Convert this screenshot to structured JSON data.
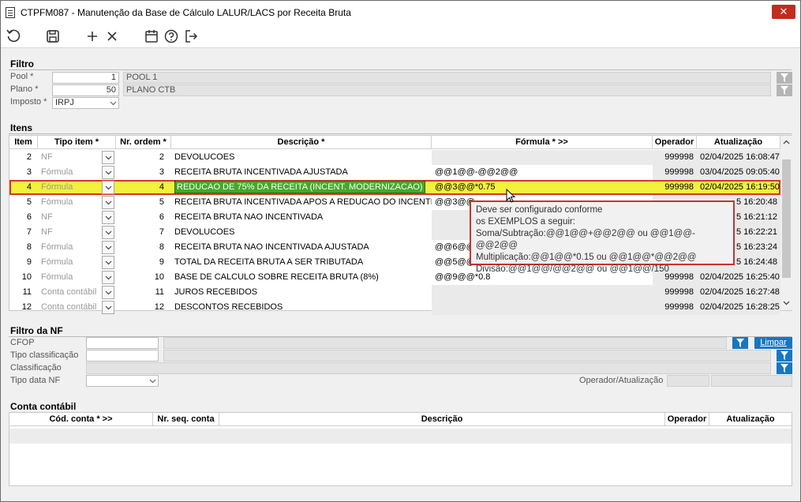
{
  "window": {
    "title": "CTPFM087 - Manutenção da Base de Cálculo LALUR/LACS por Receita Bruta",
    "close": "✕"
  },
  "filtro": {
    "title": "Filtro",
    "pool_label": "Pool *",
    "pool_value": "1",
    "pool_desc": "POOL 1",
    "plano_label": "Plano *",
    "plano_value": "50",
    "plano_desc": "PLANO CTB",
    "imposto_label": "Imposto *",
    "imposto_value": "IRPJ"
  },
  "itens": {
    "title": "Itens",
    "columns": [
      "Item",
      "Tipo item *",
      "Nr. ordem *",
      "Descrição *",
      "Fórmula * >>",
      "Operador",
      "Atualização"
    ],
    "rows": [
      {
        "item": "2",
        "tipo": "NF",
        "ordem": "2",
        "descricao": "DEVOLUCOES",
        "formula": "",
        "operador": "999998",
        "atualizacao": "02/04/2025 16:08:47"
      },
      {
        "item": "3",
        "tipo": "Fórmula",
        "ordem": "3",
        "descricao": "RECEITA BRUTA INCENTIVADA AJUSTADA",
        "formula": "@@1@@-@@2@@",
        "operador": "999998",
        "atualizacao": "03/04/2025 09:05:40"
      },
      {
        "item": "4",
        "tipo": "Fórmula",
        "ordem": "4",
        "descricao": "REDUCAO DE 75% DA RECEITA (INCENT. MODERNIZACAO)",
        "formula": "@@3@@*0.75",
        "operador": "999998",
        "atualizacao": "02/04/2025 16:19:50"
      },
      {
        "item": "5",
        "tipo": "Fórmula",
        "ordem": "5",
        "descricao": "RECEITA BRUTA INCENTIVADA APOS A REDUCAO DO INCENTIVO",
        "formula": "@@3@@",
        "operador": "",
        "atualizacao": "5 16:20:48"
      },
      {
        "item": "6",
        "tipo": "NF",
        "ordem": "6",
        "descricao": "RECEITA BRUTA NAO INCENTIVADA",
        "formula": "",
        "operador": "",
        "atualizacao": "5 16:21:12"
      },
      {
        "item": "7",
        "tipo": "NF",
        "ordem": "7",
        "descricao": "DEVOLUCOES",
        "formula": "",
        "operador": "",
        "atualizacao": "5 16:22:21"
      },
      {
        "item": "8",
        "tipo": "Fórmula",
        "ordem": "8",
        "descricao": "RECEITA BRUTA NAO INCENTIVADA AJUSTADA",
        "formula": "@@6@@",
        "operador": "",
        "atualizacao": "5 16:23:24"
      },
      {
        "item": "9",
        "tipo": "Fórmula",
        "ordem": "9",
        "descricao": "TOTAL DA RECEITA BRUTA A SER TRIBUTADA",
        "formula": "@@5@@",
        "operador": "",
        "atualizacao": "5 16:24:48"
      },
      {
        "item": "10",
        "tipo": "Fórmula",
        "ordem": "10",
        "descricao": "BASE DE CALCULO SOBRE RECEITA BRUTA (8%)",
        "formula": "@@9@@*0.8",
        "operador": "999998",
        "atualizacao": "02/04/2025 16:25:40"
      },
      {
        "item": "11",
        "tipo": "Conta contábil",
        "ordem": "11",
        "descricao": "JUROS RECEBIDOS",
        "formula": "",
        "operador": "999998",
        "atualizacao": "02/04/2025 16:27:48"
      },
      {
        "item": "12",
        "tipo": "Conta contábil",
        "ordem": "12",
        "descricao": "DESCONTOS RECEBIDOS",
        "formula": "",
        "operador": "999998",
        "atualizacao": "02/04/2025 16:28:25"
      }
    ],
    "tooltip": [
      "Deve ser configurado conforme",
      "os EXEMPLOS a seguir:",
      "Soma/Subtração:@@1@@+@@2@@ ou @@1@@-@@2@@",
      "Multiplicação:@@1@@*0.15 ou @@1@@*@@2@@",
      "Divisão:@@1@@/@@2@@ ou @@1@@/150"
    ]
  },
  "filtro_nf": {
    "title": "Filtro da NF",
    "cfop_label": "CFOP",
    "tipo_class_label": "Tipo classificação",
    "class_label": "Classificação",
    "tipo_data_label": "Tipo data NF",
    "limpar_label": "Limpar",
    "op_label": "Operador/Atualização"
  },
  "conta_contabil": {
    "title": "Conta contábil",
    "columns": [
      "Cód. conta * >>",
      "Nr. seq. conta",
      "Descrição",
      "Operador",
      "Atualização"
    ]
  },
  "colors": {
    "selected_row": "#f2f23c",
    "selected_border": "#d9342b",
    "desc_highlight": "#45a82a",
    "tooltip_border": "#c8332e",
    "filter_blue": "#1677c5"
  }
}
